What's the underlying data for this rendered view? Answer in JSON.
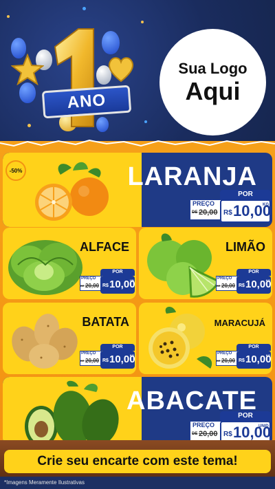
{
  "header": {
    "badge_text": "ANO",
    "badge_number": "1",
    "logo_line1": "Sua Logo",
    "logo_line2": "Aqui"
  },
  "discount_badge": "-50%",
  "products": {
    "laranja": {
      "name": "LARANJA",
      "por": "POR",
      "preco_label": "PREÇO",
      "de": "DE",
      "old_price": "20,00",
      "currency": "R$",
      "price": "10,00",
      "unit": "KG"
    },
    "alface": {
      "name": "ALFACE",
      "por": "POR",
      "preco_label": "PREÇO",
      "de": "DE",
      "old_price": "20,00",
      "currency": "R$",
      "price": "10,00",
      "unit": "UN"
    },
    "limao": {
      "name": "LIMÃO",
      "por": "POR",
      "preco_label": "PREÇO",
      "de": "DE",
      "old_price": "20,00",
      "currency": "R$",
      "price": "10,00",
      "unit": "KG"
    },
    "batata": {
      "name": "BATATA",
      "por": "POR",
      "preco_label": "PREÇO",
      "de": "DE",
      "old_price": "20,00",
      "currency": "R$",
      "price": "10,00",
      "unit": "KG"
    },
    "maracuja": {
      "name": "MARACUJÁ",
      "por": "POR",
      "preco_label": "PREÇO",
      "de": "DE",
      "old_price": "20,00",
      "currency": "R$",
      "price": "10,00",
      "unit": "KG"
    },
    "abacate": {
      "name": "ABACATE",
      "por": "POR",
      "preco_label": "PREÇO",
      "de": "DE",
      "old_price": "20,00",
      "currency": "R$",
      "price": "10,00",
      "unit": "UNID"
    }
  },
  "cta": "Crie seu encarte com este tema!",
  "disclaimer": "*Imagens Meramente Ilustrativas",
  "colors": {
    "navy": "#1c2f63",
    "brand_blue": "#1c3a96",
    "yellow": "#ffd21a",
    "orange": "#f39212"
  }
}
